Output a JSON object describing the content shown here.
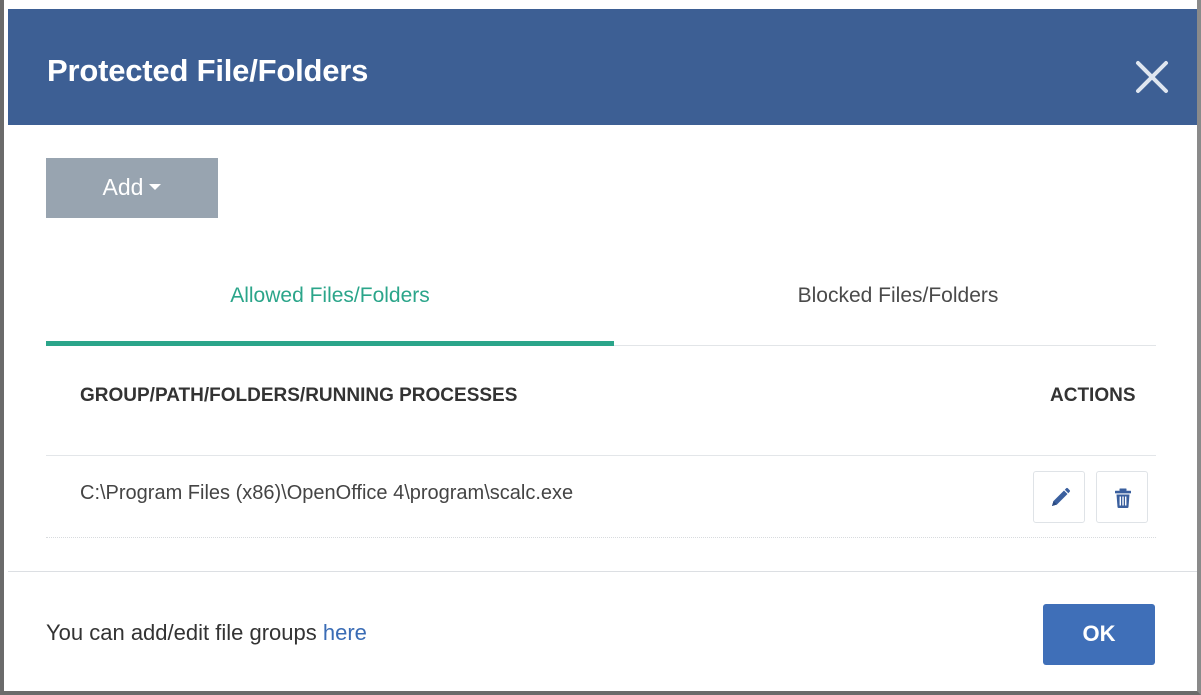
{
  "dialog": {
    "title": "Protected File/Folders",
    "close_icon": "close-icon",
    "header_color": "#3d5f94"
  },
  "toolbar": {
    "add_label": "Add",
    "add_icon": "caret-down-icon"
  },
  "tabs": [
    {
      "label": "Allowed Files/Folders",
      "active": true
    },
    {
      "label": "Blocked Files/Folders",
      "active": false
    }
  ],
  "table": {
    "headers": {
      "path": "GROUP/PATH/FOLDERS/RUNNING PROCESSES",
      "actions": "ACTIONS"
    },
    "rows": [
      {
        "path": "C:\\Program Files (x86)\\OpenOffice 4\\program\\scalc.exe",
        "edit_icon": "pencil-icon",
        "delete_icon": "trash-icon"
      }
    ]
  },
  "footer": {
    "text": "You can add/edit file groups ",
    "link_text": "here",
    "ok_label": "OK"
  },
  "colors": {
    "accent_green": "#2ba58a",
    "primary_blue": "#3f6fb8",
    "link_blue": "#3a6cb5",
    "add_button_gray": "#98a4b0"
  }
}
